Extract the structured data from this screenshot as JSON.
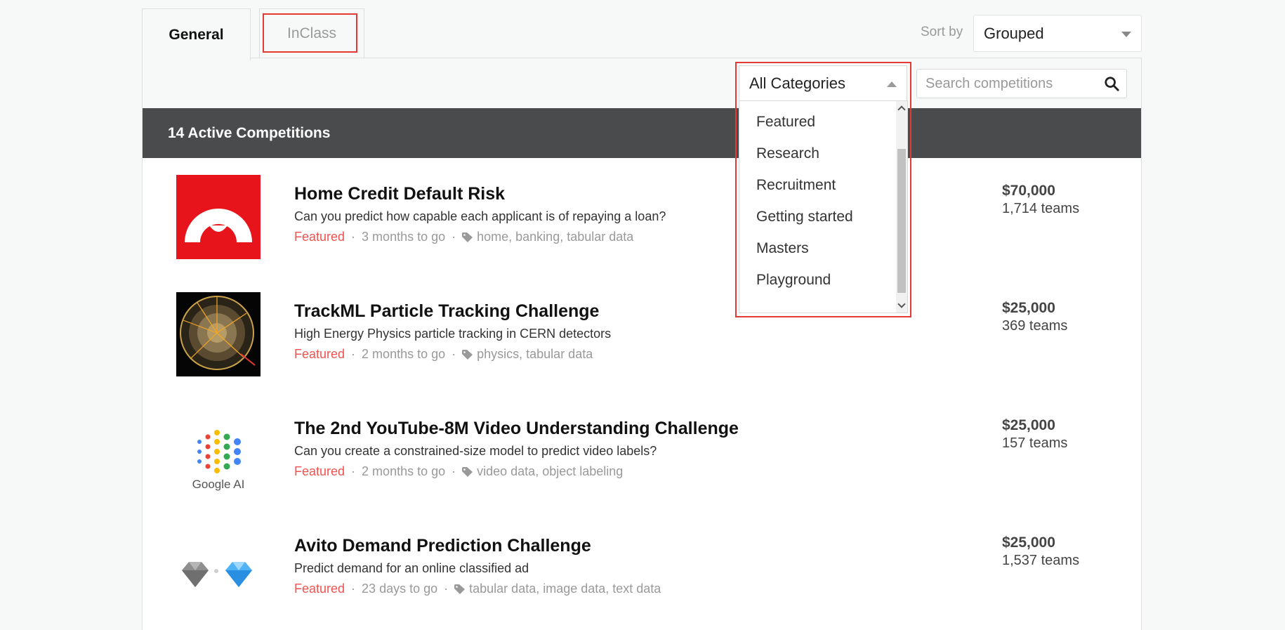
{
  "tabs": {
    "general": "General",
    "inclass": "InClass"
  },
  "sort": {
    "label": "Sort by",
    "value": "Grouped"
  },
  "filter": {
    "category_value": "All Categories",
    "category_options": [
      "Featured",
      "Research",
      "Recruitment",
      "Getting started",
      "Masters",
      "Playground"
    ],
    "search_placeholder": "Search competitions"
  },
  "header": {
    "active_count": "14 Active Competitions"
  },
  "competitions": [
    {
      "title": "Home Credit Default Risk",
      "description": "Can you predict how capable each applicant is of repaying a loan?",
      "category": "Featured",
      "deadline": "3 months to go",
      "tags": "home, banking, tabular data",
      "prize": "$70,000",
      "teams": "1,714 teams",
      "logo": "home-credit-logo"
    },
    {
      "title": "TrackML Particle Tracking Challenge",
      "description": "High Energy Physics particle tracking in CERN detectors",
      "category": "Featured",
      "deadline": "2 months to go",
      "tags": "physics, tabular data",
      "prize": "$25,000",
      "teams": "369 teams",
      "logo": "particle-tracks-logo"
    },
    {
      "title": "The 2nd YouTube-8M Video Understanding Challenge",
      "description": "Can you create a constrained-size model to predict video labels?",
      "category": "Featured",
      "deadline": "2 months to go",
      "tags": "video data, object labeling",
      "prize": "$25,000",
      "teams": "157 teams",
      "logo": "google-ai-logo",
      "logo_text": "Google AI"
    },
    {
      "title": "Avito Demand Prediction Challenge",
      "description": "Predict demand for an online classified ad",
      "category": "Featured",
      "deadline": "23 days to go",
      "tags": "tabular data, image data, text data",
      "prize": "$25,000",
      "teams": "1,537 teams",
      "logo": "diamonds-logo"
    }
  ],
  "colors": {
    "accent_red": "#ef5350",
    "dark_bar": "#4a4b4d",
    "highlight": "#e53935"
  }
}
